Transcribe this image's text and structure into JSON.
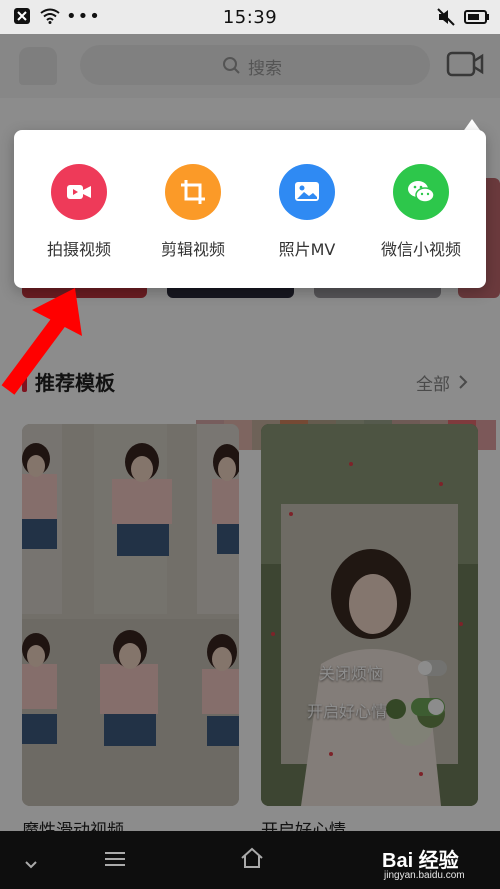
{
  "status_bar": {
    "time": "15:39"
  },
  "search": {
    "placeholder": "搜索"
  },
  "popup": {
    "actions": [
      {
        "label": "拍摄视频",
        "icon": "video-camera-icon",
        "color": "#ee3a59"
      },
      {
        "label": "剪辑视频",
        "icon": "crop-icon",
        "color": "#fb9a28"
      },
      {
        "label": "照片MV",
        "icon": "photo-icon",
        "color": "#2f8af3"
      },
      {
        "label": "微信小视频",
        "icon": "wechat-icon",
        "color": "#2dc74b"
      }
    ]
  },
  "section": {
    "title": "推荐模板",
    "more": "全部"
  },
  "templates": [
    {
      "caption": "魔性滑动视频"
    },
    {
      "caption": "开启好心情",
      "overlay_lines": [
        "关闭烦恼",
        "开启好心情"
      ]
    }
  ],
  "watermark": {
    "logo": "Bai 经验",
    "url": "jingyan.baidu.com"
  },
  "colors": {
    "accent": "#e8243a",
    "annotation_arrow": "#ff0000"
  }
}
